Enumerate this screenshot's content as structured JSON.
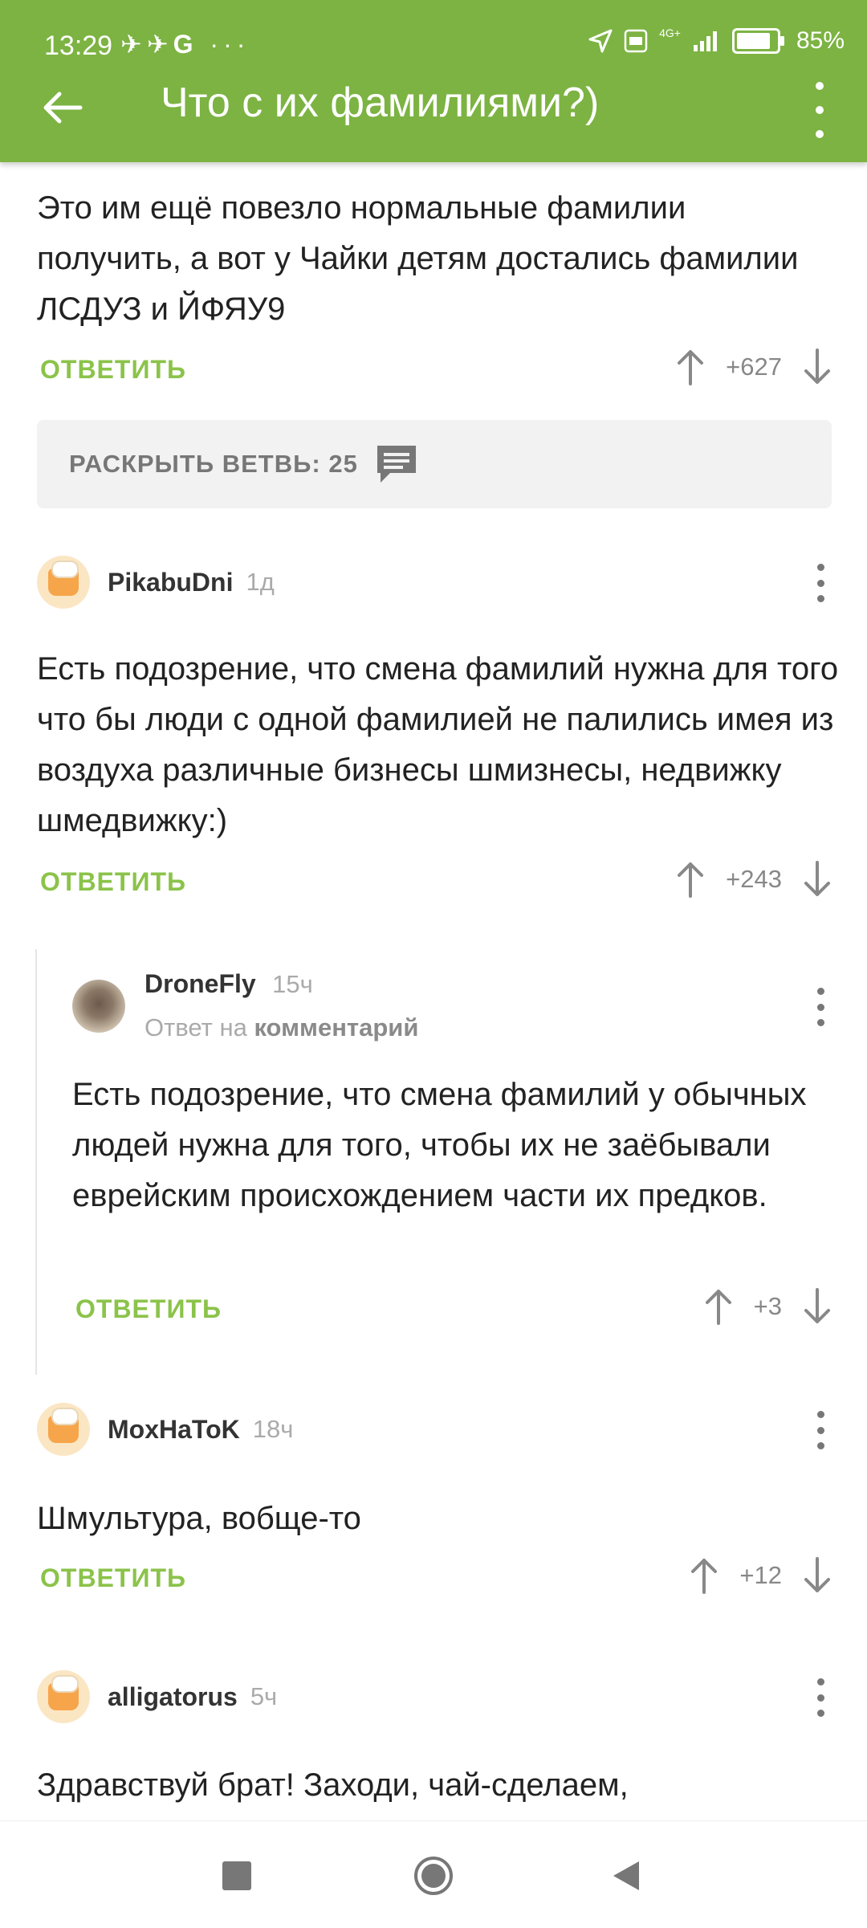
{
  "status_bar": {
    "time": "13:29",
    "left_icons": [
      "notification-icon",
      "notification-icon",
      "google-icon",
      "more-dots-icon"
    ],
    "google_glyph": "G",
    "dots_glyph": "···",
    "network": "4G+",
    "battery": "85%",
    "battery_level": 0.85
  },
  "appbar": {
    "title": "Что с их фамилиями?)"
  },
  "colors": {
    "accent": "#7cb342",
    "reply": "#8bc34a"
  },
  "comments": [
    {
      "text": "Это им ещё повезло нормальные фамилии получить, а вот у Чайки детям достались фамилии ЛСДУЗ и ЙФЯУ9",
      "reply_label": "ОТВЕТИТЬ",
      "rating": "+627"
    },
    {
      "author": "PikabuDni",
      "time": "1д",
      "text": "Есть подозрение, что смена фамилий нужна для того что бы люди с одной фамилией не палились имея из воздуха различные бизнесы шмизнесы, недвижку шмедвижку:)",
      "reply_label": "ОТВЕТИТЬ",
      "rating": "+243"
    },
    {
      "author": "DroneFly",
      "time": "15ч",
      "reply_to_prefix": "Ответ на",
      "reply_to_target": "комментарий",
      "text": "Есть подозрение, что смена фамилий у обычных людей нужна для того, чтобы их не заёбывали еврейским происхождением части их предков.",
      "reply_label": "ОТВЕТИТЬ",
      "rating": "+3"
    },
    {
      "author": "MoxHaToK",
      "time": "18ч",
      "text": "Шмультура, вобще-то",
      "reply_label": "ОТВЕТИТЬ",
      "rating": "+12"
    },
    {
      "author": "alligatorus",
      "time": "5ч",
      "text": "Здравствуй брат! Заходи, чай-сделаем,"
    }
  ],
  "expand_branch": {
    "label": "РАСКРЫТЬ ВЕТВЬ: 25"
  },
  "nav": [
    "recents-icon",
    "home-icon",
    "back-icon"
  ]
}
